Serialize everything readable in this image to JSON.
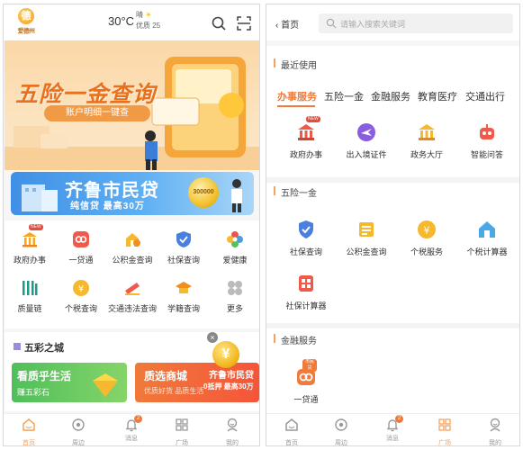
{
  "left": {
    "header": {
      "logo_text": "爱德州",
      "temperature": "30°C",
      "weather": "晴",
      "air_quality": "优质 25",
      "icons": [
        "search-icon",
        "scan-icon"
      ]
    },
    "banner1": {
      "title": "五险一金查询",
      "subtitle": "账户明细一键查"
    },
    "banner2": {
      "title": "齐鲁市民贷",
      "subtitle": "纯信贷  最高30万",
      "coin_text": "300000"
    },
    "services": [
      {
        "label": "政府办事",
        "icon": "government-building-icon",
        "new": true
      },
      {
        "label": "一贷通",
        "icon": "loan-icon"
      },
      {
        "label": "公积金查询",
        "icon": "housing-fund-icon"
      },
      {
        "label": "社保查询",
        "icon": "social-security-icon"
      },
      {
        "label": "爱健康",
        "icon": "health-icon"
      },
      {
        "label": "质量链",
        "icon": "quality-chain-icon"
      },
      {
        "label": "个税查询",
        "icon": "tax-icon"
      },
      {
        "label": "交通违法查询",
        "icon": "traffic-violation-icon"
      },
      {
        "label": "学籍查询",
        "icon": "student-record-icon"
      },
      {
        "label": "更多",
        "icon": "more-icon"
      }
    ],
    "colorful": {
      "title": "五彩之城",
      "card1_title": "看质乎生活",
      "card1_sub": "赚五彩石",
      "card2_title": "质选商城",
      "card2_sub": "优质好货 品质生活",
      "card2_right1": "齐鲁市民贷",
      "card2_right2": "0抵押 最高30万",
      "coin_symbol": "¥",
      "close": "×"
    },
    "tabs": [
      {
        "label": "首页",
        "icon": "home-icon",
        "active": true
      },
      {
        "label": "周边",
        "icon": "nearby-icon"
      },
      {
        "label": "消息",
        "icon": "message-icon",
        "badge": "2"
      },
      {
        "label": "广场",
        "icon": "square-icon"
      },
      {
        "label": "我的",
        "icon": "profile-icon"
      }
    ]
  },
  "right": {
    "header": {
      "back_label": "首页",
      "search_placeholder": "请输入搜索关键词"
    },
    "recent": {
      "title": "最近使用",
      "categories": [
        "办事服务",
        "五险一金",
        "金融服务",
        "教育医疗",
        "交通出行"
      ],
      "items": [
        {
          "label": "政府办事",
          "icon": "government-building-icon",
          "new": true
        },
        {
          "label": "出入境证件",
          "icon": "passport-icon"
        },
        {
          "label": "政务大厅",
          "icon": "government-hall-icon"
        },
        {
          "label": "智能问答",
          "icon": "robot-icon"
        }
      ]
    },
    "insurance": {
      "title": "五险一金",
      "items": [
        {
          "label": "社保查询",
          "icon": "social-security-icon"
        },
        {
          "label": "公积金查询",
          "icon": "housing-fund-icon"
        },
        {
          "label": "个税服务",
          "icon": "tax-icon"
        },
        {
          "label": "个税计算器",
          "icon": "tax-calculator-icon"
        },
        {
          "label": "社保计算器",
          "icon": "social-calculator-icon"
        }
      ]
    },
    "finance": {
      "title": "金融服务",
      "items": [
        {
          "label": "一贷通",
          "icon": "loan-icon",
          "tag": "市民贷"
        }
      ]
    },
    "tabs": [
      {
        "label": "首页",
        "icon": "home-icon"
      },
      {
        "label": "周边",
        "icon": "nearby-icon"
      },
      {
        "label": "消息",
        "icon": "message-icon",
        "badge": "2"
      },
      {
        "label": "广场",
        "icon": "square-icon",
        "active": true
      },
      {
        "label": "我的",
        "icon": "profile-icon"
      }
    ]
  },
  "colors": {
    "accent": "#f07a3a",
    "tab_active": "#f5a25c",
    "banner_blue": "#3f8fe6",
    "green": "#4fbf5a"
  }
}
